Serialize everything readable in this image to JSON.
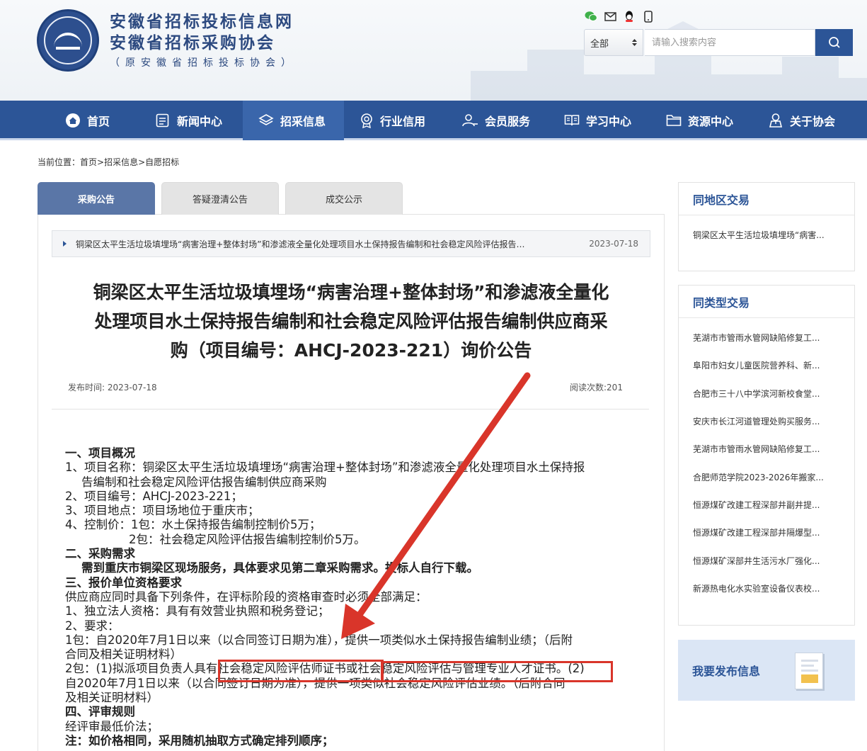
{
  "header": {
    "site_title": "安徽省招标投标信息网",
    "association": "安徽省招标采购协会",
    "former_name": "（原安徽省招标投标协会）"
  },
  "top_icons": [
    "wechat-icon",
    "mail-icon",
    "qq-icon",
    "mobile-icon"
  ],
  "search": {
    "scope": "全部",
    "placeholder": "请输入搜索内容"
  },
  "nav": {
    "items": [
      {
        "label": "首页",
        "icon": "home-icon"
      },
      {
        "label": "新闻中心",
        "icon": "news-icon"
      },
      {
        "label": "招采信息",
        "icon": "layers-icon",
        "active": true
      },
      {
        "label": "行业信用",
        "icon": "badge-icon"
      },
      {
        "label": "会员服务",
        "icon": "members-icon"
      },
      {
        "label": "学习中心",
        "icon": "book-icon"
      },
      {
        "label": "资源中心",
        "icon": "folder-icon"
      },
      {
        "label": "关于协会",
        "icon": "user-icon"
      }
    ]
  },
  "breadcrumb": {
    "prefix": "当前位置：",
    "home": "首页",
    "sep1": ">",
    "section": "招采信息",
    "sep2": ">",
    "current": "自愿招标"
  },
  "tabs": [
    {
      "label": "采购公告",
      "active": true
    },
    {
      "label": "答疑澄清公告"
    },
    {
      "label": "成交公示"
    }
  ],
  "announcement_bar": {
    "text": "铜梁区太平生活垃圾填埋场“病害治理+整体封场”和渗滤液全量化处理项目水土保持报告编制和社会稳定风险评估报告编制供应商采购",
    "date": "2023-07-18"
  },
  "article": {
    "title_lines": [
      "铜梁区太平生活垃圾填埋场“病害治理+整体封场”和渗滤液全量化",
      "处理项目水土保持报告编制和社会稳定风险评估报告编制供应商采",
      "购（项目编号：AHCJ-2023-221）询价公告"
    ],
    "publish_label": "发布时间: 2023-07-18",
    "views_label": "阅读次数:201",
    "body": [
      {
        "text": "一、项目概况",
        "style": "b"
      },
      {
        "text": "1、项目名称：铜梁区太平生活垃圾填埋场“病害治理+整体封场”和渗滤液全量化处理项目水土保持报",
        "style": ""
      },
      {
        "text": "告编制和社会稳定风险评估报告编制供应商采购",
        "style": "ind"
      },
      {
        "text": "2、项目编号：AHCJ-2023-221；",
        "style": ""
      },
      {
        "text": "3、项目地点：项目场地位于重庆市；",
        "style": ""
      },
      {
        "text": "4、控制价：1包：水土保持报告编制控制价5万；",
        "style": ""
      },
      {
        "text": "2包：社会稳定风险评估报告编制控制价5万。",
        "style": "ind2"
      },
      {
        "text": "二、采购需求",
        "style": "b"
      },
      {
        "text": "需到重庆市铜梁区现场服务，具体要求见第二章采购需求。投标人自行下载。",
        "style": "b ind"
      },
      {
        "text": "三、报价单位资格要求",
        "style": "b"
      },
      {
        "text": "供应商应同时具备下列条件，在评标阶段的资格审查时必须全部满足：",
        "style": ""
      },
      {
        "text": "1、独立法人资格：具有有效营业执照和税务登记；",
        "style": ""
      },
      {
        "text": "2、要求：",
        "style": ""
      },
      {
        "text": "1包：自2020年7月1日以来（以合同签订日期为准），提供一项类似水土保持报告编制业绩；（后附",
        "style": ""
      },
      {
        "text": "合同及相关证明材料）",
        "style": ""
      },
      {
        "text": "2包：(1)拟派项目负责人具有社会稳定风险评估师证书或社会稳定风险评估与管理专业人才证书。(2)",
        "style": ""
      },
      {
        "text": "自2020年7月1日以来（以合同签订日期为准），提供一项类似社会稳定风险评估业绩。（后附合同",
        "style": ""
      },
      {
        "text": "及相关证明材料）",
        "style": ""
      },
      {
        "text": "四、评审规则",
        "style": "b"
      },
      {
        "text": "经评审最低价法；",
        "style": ""
      },
      {
        "text": "注：如价格相同，采用随机抽取方式确定排列顺序；",
        "style": "b"
      }
    ]
  },
  "sidebar": {
    "same_region": {
      "title": "同地区交易",
      "items": [
        "铜梁区太平生活垃圾填埋场“病害..."
      ]
    },
    "same_type": {
      "title": "同类型交易",
      "items": [
        "芜湖市市管雨水管网缺陷修复工...",
        "阜阳市妇女儿童医院营养科、新...",
        "合肥市三十八中学滨河新校食堂...",
        "安庆市长江河道管理处购买服务...",
        "芜湖市市管雨水管网缺陷修复工...",
        "合肥师范学院2023-2026年搬家...",
        "恒源煤矿改建工程深部井副井提...",
        "恒源煤矿改建工程深部井隔爆型...",
        "恒源煤矿深部井生活污水厂强化...",
        "新源热电化水实验室设备仪表校..."
      ]
    },
    "publish_label": "我要发布信息"
  },
  "colors": {
    "nav_bg": "#2c5597",
    "nav_active": "#3a66ab",
    "tab_active": "#5a76a7",
    "highlight_red": "#d9352a"
  }
}
